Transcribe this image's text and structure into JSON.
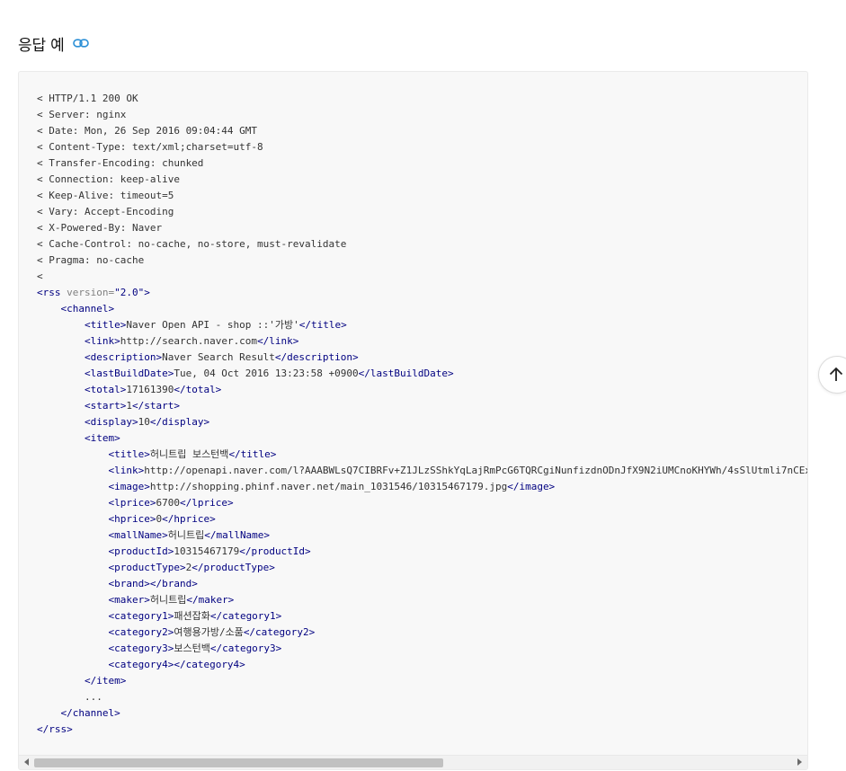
{
  "section": {
    "heading": "응답 예",
    "link_icon": "link-icon"
  },
  "code_lines": [
    {
      "indent": "",
      "segments": [
        {
          "t": "text",
          "v": "< HTTP/1.1 200 OK"
        }
      ]
    },
    {
      "indent": "",
      "segments": [
        {
          "t": "text",
          "v": "< Server: nginx"
        }
      ]
    },
    {
      "indent": "",
      "segments": [
        {
          "t": "text",
          "v": "< Date: Mon, 26 Sep 2016 09:04:44 GMT"
        }
      ]
    },
    {
      "indent": "",
      "segments": [
        {
          "t": "text",
          "v": "< Content-Type: text/xml;charset=utf-8"
        }
      ]
    },
    {
      "indent": "",
      "segments": [
        {
          "t": "text",
          "v": "< Transfer-Encoding: chunked"
        }
      ]
    },
    {
      "indent": "",
      "segments": [
        {
          "t": "text",
          "v": "< Connection: keep-alive"
        }
      ]
    },
    {
      "indent": "",
      "segments": [
        {
          "t": "text",
          "v": "< Keep-Alive: timeout=5"
        }
      ]
    },
    {
      "indent": "",
      "segments": [
        {
          "t": "text",
          "v": "< Vary: Accept-Encoding"
        }
      ]
    },
    {
      "indent": "",
      "segments": [
        {
          "t": "text",
          "v": "< X-Powered-By: Naver"
        }
      ]
    },
    {
      "indent": "",
      "segments": [
        {
          "t": "text",
          "v": "< Cache-Control: no-cache, no-store, must-revalidate"
        }
      ]
    },
    {
      "indent": "",
      "segments": [
        {
          "t": "text",
          "v": "< Pragma: no-cache"
        }
      ]
    },
    {
      "indent": "",
      "segments": [
        {
          "t": "text",
          "v": "<"
        }
      ]
    },
    {
      "indent": "",
      "segments": [
        {
          "t": "tag",
          "v": "<rss "
        },
        {
          "t": "attr",
          "v": "version="
        },
        {
          "t": "str",
          "v": "\"2.0\""
        },
        {
          "t": "tag",
          "v": ">"
        }
      ]
    },
    {
      "indent": "    ",
      "segments": [
        {
          "t": "tag",
          "v": "<channel>"
        }
      ]
    },
    {
      "indent": "        ",
      "segments": [
        {
          "t": "tag",
          "v": "<title>"
        },
        {
          "t": "text",
          "v": "Naver Open API - shop ::'가방'"
        },
        {
          "t": "tag",
          "v": "</title>"
        }
      ]
    },
    {
      "indent": "        ",
      "segments": [
        {
          "t": "tag",
          "v": "<link>"
        },
        {
          "t": "text",
          "v": "http://search.naver.com"
        },
        {
          "t": "tag",
          "v": "</link>"
        }
      ]
    },
    {
      "indent": "        ",
      "segments": [
        {
          "t": "tag",
          "v": "<description>"
        },
        {
          "t": "text",
          "v": "Naver Search Result"
        },
        {
          "t": "tag",
          "v": "</description>"
        }
      ]
    },
    {
      "indent": "        ",
      "segments": [
        {
          "t": "tag",
          "v": "<lastBuildDate>"
        },
        {
          "t": "text",
          "v": "Tue, 04 Oct 2016 13:23:58 +0900"
        },
        {
          "t": "tag",
          "v": "</lastBuildDate>"
        }
      ]
    },
    {
      "indent": "        ",
      "segments": [
        {
          "t": "tag",
          "v": "<total>"
        },
        {
          "t": "text",
          "v": "17161390"
        },
        {
          "t": "tag",
          "v": "</total>"
        }
      ]
    },
    {
      "indent": "        ",
      "segments": [
        {
          "t": "tag",
          "v": "<start>"
        },
        {
          "t": "text",
          "v": "1"
        },
        {
          "t": "tag",
          "v": "</start>"
        }
      ]
    },
    {
      "indent": "        ",
      "segments": [
        {
          "t": "tag",
          "v": "<display>"
        },
        {
          "t": "text",
          "v": "10"
        },
        {
          "t": "tag",
          "v": "</display>"
        }
      ]
    },
    {
      "indent": "        ",
      "segments": [
        {
          "t": "tag",
          "v": "<item>"
        }
      ]
    },
    {
      "indent": "            ",
      "segments": [
        {
          "t": "tag",
          "v": "<title>"
        },
        {
          "t": "text",
          "v": "허니트립 보스턴백"
        },
        {
          "t": "tag",
          "v": "</title>"
        }
      ]
    },
    {
      "indent": "            ",
      "segments": [
        {
          "t": "tag",
          "v": "<link>"
        },
        {
          "t": "text",
          "v": "http://openapi.naver.com/l?AAABWLsQ7CIBRFv+Z1JLzSShkYqLajRmPcG6TQRCgiNunfizdnODnJfX9N2iUMCnoKHYWh/4sSlUtmli7nCEx"
        }
      ]
    },
    {
      "indent": "            ",
      "segments": [
        {
          "t": "tag",
          "v": "<image>"
        },
        {
          "t": "text",
          "v": "http://shopping.phinf.naver.net/main_1031546/10315467179.jpg"
        },
        {
          "t": "tag",
          "v": "</image>"
        }
      ]
    },
    {
      "indent": "            ",
      "segments": [
        {
          "t": "tag",
          "v": "<lprice>"
        },
        {
          "t": "text",
          "v": "6700"
        },
        {
          "t": "tag",
          "v": "</lprice>"
        }
      ]
    },
    {
      "indent": "            ",
      "segments": [
        {
          "t": "tag",
          "v": "<hprice>"
        },
        {
          "t": "text",
          "v": "0"
        },
        {
          "t": "tag",
          "v": "</hprice>"
        }
      ]
    },
    {
      "indent": "            ",
      "segments": [
        {
          "t": "tag",
          "v": "<mallName>"
        },
        {
          "t": "text",
          "v": "허니트립"
        },
        {
          "t": "tag",
          "v": "</mallName>"
        }
      ]
    },
    {
      "indent": "            ",
      "segments": [
        {
          "t": "tag",
          "v": "<productId>"
        },
        {
          "t": "text",
          "v": "10315467179"
        },
        {
          "t": "tag",
          "v": "</productId>"
        }
      ]
    },
    {
      "indent": "            ",
      "segments": [
        {
          "t": "tag",
          "v": "<productType>"
        },
        {
          "t": "text",
          "v": "2"
        },
        {
          "t": "tag",
          "v": "</productType>"
        }
      ]
    },
    {
      "indent": "            ",
      "segments": [
        {
          "t": "tag",
          "v": "<brand></brand>"
        }
      ]
    },
    {
      "indent": "            ",
      "segments": [
        {
          "t": "tag",
          "v": "<maker>"
        },
        {
          "t": "text",
          "v": "허니트립"
        },
        {
          "t": "tag",
          "v": "</maker>"
        }
      ]
    },
    {
      "indent": "            ",
      "segments": [
        {
          "t": "tag",
          "v": "<category1>"
        },
        {
          "t": "text",
          "v": "패션잡화"
        },
        {
          "t": "tag",
          "v": "</category1>"
        }
      ]
    },
    {
      "indent": "            ",
      "segments": [
        {
          "t": "tag",
          "v": "<category2>"
        },
        {
          "t": "text",
          "v": "여행용가방/소품"
        },
        {
          "t": "tag",
          "v": "</category2>"
        }
      ]
    },
    {
      "indent": "            ",
      "segments": [
        {
          "t": "tag",
          "v": "<category3>"
        },
        {
          "t": "text",
          "v": "보스턴백"
        },
        {
          "t": "tag",
          "v": "</category3>"
        }
      ]
    },
    {
      "indent": "            ",
      "segments": [
        {
          "t": "tag",
          "v": "<category4></category4>"
        }
      ]
    },
    {
      "indent": "        ",
      "segments": [
        {
          "t": "tag",
          "v": "</item>"
        }
      ]
    },
    {
      "indent": "        ",
      "segments": [
        {
          "t": "text",
          "v": "..."
        }
      ]
    },
    {
      "indent": "    ",
      "segments": [
        {
          "t": "tag",
          "v": "</channel>"
        }
      ]
    },
    {
      "indent": "",
      "segments": [
        {
          "t": "tag",
          "v": "</rss>"
        }
      ]
    }
  ],
  "scrollbar": {
    "horizontal_position": 0,
    "visible_fraction": 0.54
  },
  "back_to_top": {
    "icon": "arrow-up-icon"
  },
  "colors": {
    "tag": "#000080",
    "attr": "#808080",
    "text": "#333333",
    "link_icon": "#2b8fd6",
    "panel_bg": "#f8f8f8"
  }
}
